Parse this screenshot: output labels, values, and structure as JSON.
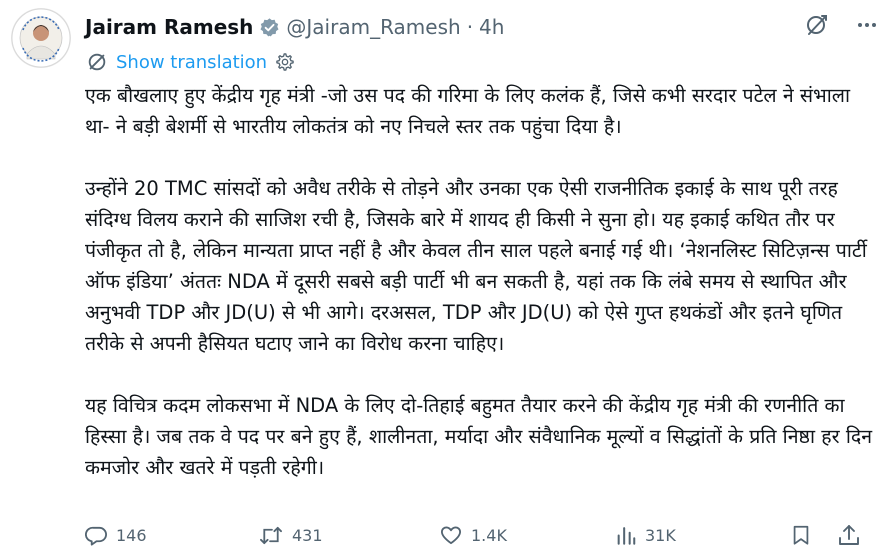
{
  "author": {
    "name": "Jairam Ramesh",
    "handle": "@Jairam_Ramesh",
    "separator": "·",
    "time": "4h"
  },
  "translate": {
    "label": "Show translation"
  },
  "body": {
    "paragraphs": [
      "एक बौखलाए हुए केंद्रीय गृह मंत्री -जो उस पद की गरिमा के लिए कलंक हैं, जिसे कभी सरदार पटेल ने संभाला था- ने बड़ी बेशर्मी से भारतीय लोकतंत्र को नए निचले स्तर तक पहुंचा दिया है।",
      "उन्होंने 20 TMC सांसदों को अवैध तरीके से तोड़ने और उनका एक ऐसी राजनीतिक इकाई के साथ पूरी तरह संदिग्ध विलय कराने की साजिश रची है, जिसके बारे में शायद ही किसी ने सुना हो। यह इकाई कथित तौर पर पंजीकृत तो है, लेकिन मान्यता प्राप्त नहीं है और केवल तीन साल पहले बनाई गई थी। ‘नेशनलिस्ट सिटिज़न्स पार्टी ऑफ इंडिया’ अंततः NDA में दूसरी सबसे बड़ी पार्टी भी बन सकती है, यहां तक कि लंबे समय से स्थापित और अनुभवी TDP और JD(U) से भी आगे। दरअसल, TDP और JD(U) को ऐसे गुप्त हथकंडों और इतने घृणित तरीके से अपनी हैसियत घटाए जाने का विरोध करना चाहिए।",
      "यह विचित्र कदम लोकसभा में NDA के लिए दो-तिहाई बहुमत तैयार करने की केंद्रीय गृह मंत्री की रणनीति का हिस्सा है। जब तक वे पद पर बने हुए हैं, शालीनता, मर्यादा और संवैधानिक मूल्यों व सिद्धांतों के प्रति निष्ठा हर दिन कमजोर और खतरे में पड़ती रहेगी।"
    ]
  },
  "stats": {
    "replies": "146",
    "reposts": "431",
    "likes": "1.4K",
    "views": "31K"
  },
  "icons": {
    "verified": "verified-badge-icon",
    "grok": "grok-icon",
    "more": "more-icon",
    "translate": "translate-icon",
    "settings": "gear-icon",
    "reply": "reply-icon",
    "repost": "repost-icon",
    "like": "heart-icon",
    "views": "views-icon",
    "bookmark": "bookmark-icon",
    "share": "share-icon"
  },
  "colors": {
    "text": "#0f1419",
    "secondary": "#536471",
    "link": "#1d9bf0",
    "verified": "#829aab"
  }
}
